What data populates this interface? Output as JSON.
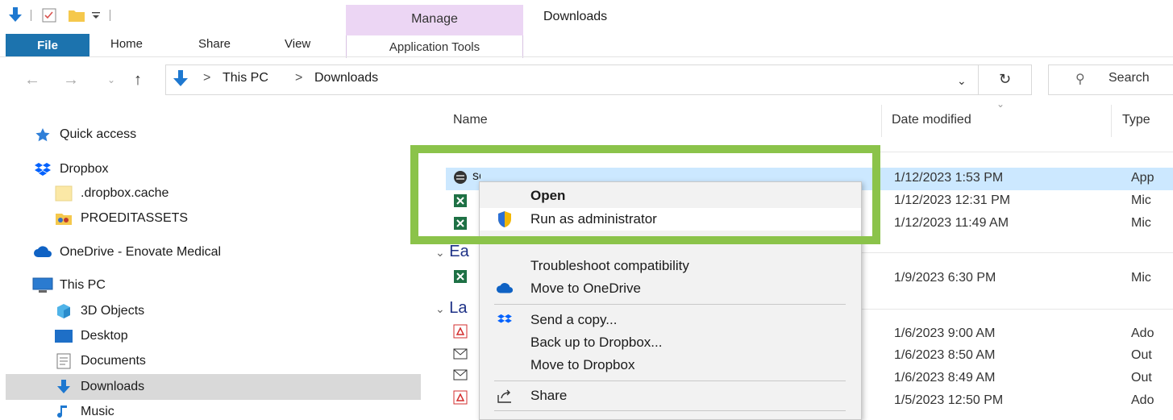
{
  "window": {
    "title": "Downloads"
  },
  "ribbon": {
    "tabs": {
      "file": "File",
      "home": "Home",
      "share": "Share",
      "view": "View"
    },
    "manage": {
      "label": "Manage",
      "subtab": "Application Tools"
    }
  },
  "address": {
    "separator": ">",
    "crumb1": "This PC",
    "crumb2": "Downloads",
    "search_placeholder": "Search"
  },
  "sidebar": {
    "items": [
      {
        "label": "Quick access",
        "icon": "star-icon"
      },
      {
        "label": "Dropbox",
        "icon": "dropbox-icon"
      },
      {
        "label": ".dropbox.cache",
        "icon": "folder-icon"
      },
      {
        "label": "PROEDITASSETS",
        "icon": "shared-folder-icon"
      },
      {
        "label": "OneDrive - Enovate Medical",
        "icon": "onedrive-cloud-icon"
      },
      {
        "label": "This PC",
        "icon": "computer-icon"
      },
      {
        "label": "3D Objects",
        "icon": "3d-objects-icon"
      },
      {
        "label": "Desktop",
        "icon": "desktop-icon"
      },
      {
        "label": "Documents",
        "icon": "documents-icon"
      },
      {
        "label": "Downloads",
        "icon": "download-arrow-icon"
      },
      {
        "label": "Music",
        "icon": "music-icon"
      }
    ]
  },
  "columns": {
    "name": "Name",
    "date": "Date modified",
    "type": "Type"
  },
  "groups": {
    "earlier": "Ea",
    "last": "La"
  },
  "files": [
    {
      "name": "setup.exe",
      "date": "1/12/2023 1:53 PM",
      "type": "App"
    },
    {
      "date": "1/12/2023 12:31 PM",
      "type": "Mic"
    },
    {
      "date": "1/12/2023 11:49 AM",
      "type": "Mic"
    },
    {
      "date": "1/9/2023 6:30 PM",
      "type": "Mic"
    },
    {
      "date": "1/6/2023 9:00 AM",
      "type": "Ado"
    },
    {
      "date": "1/6/2023 8:50 AM",
      "type": "Out"
    },
    {
      "date": "1/6/2023 8:49 AM",
      "type": "Out"
    },
    {
      "date": "1/5/2023 12:50 PM",
      "type": "Ado"
    }
  ],
  "context_menu": {
    "open": "Open",
    "run_as_admin": "Run as administrator",
    "troubleshoot": "Troubleshoot compatibility",
    "move_onedrive": "Move to OneDrive",
    "send_copy": "Send a copy...",
    "backup_dropbox": "Back up to Dropbox...",
    "move_dropbox": "Move to Dropbox",
    "share": "Share"
  },
  "colors": {
    "file_tab": "#1c73ae",
    "manage_tab": "#ecd6f4",
    "highlight_border": "#8bc34a",
    "selection": "#cce8ff"
  }
}
